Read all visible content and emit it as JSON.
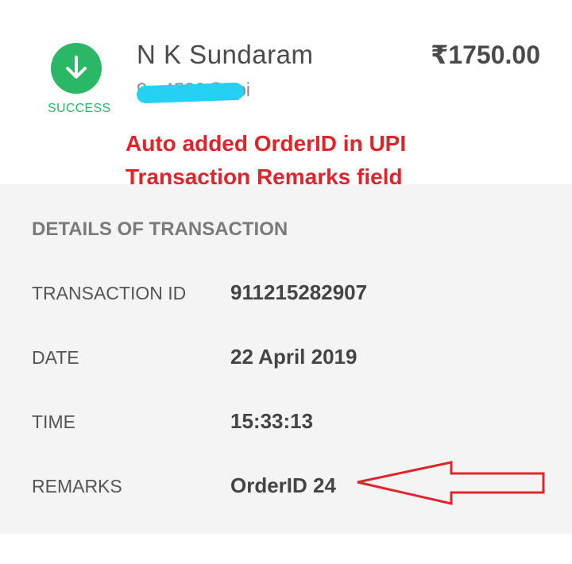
{
  "payee": {
    "name": "N K Sundaram",
    "upi_id": "9...4580@upi",
    "amount": "₹1750.00"
  },
  "status": {
    "label": "SUCCESS",
    "icon": "arrow-down-icon",
    "color": "#2bb866"
  },
  "annotation": {
    "line1": "Auto added OrderID in UPI",
    "line2": "Transaction Remarks field",
    "color": "#e0242b"
  },
  "details": {
    "title": "DETAILS OF TRANSACTION",
    "rows": [
      {
        "label": "TRANSACTION ID",
        "value": "911215282907"
      },
      {
        "label": "DATE",
        "value": "22 April 2019"
      },
      {
        "label": "TIME",
        "value": "15:33:13"
      },
      {
        "label": "REMARKS",
        "value": "OrderID 24"
      }
    ]
  }
}
